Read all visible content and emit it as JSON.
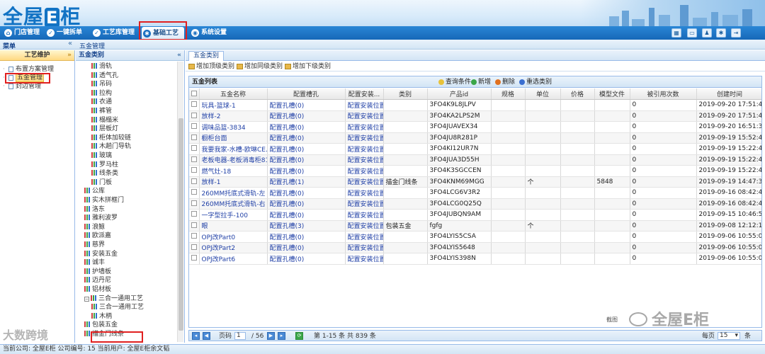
{
  "app": {
    "logo_pre": "全屋",
    "logo_e": "E",
    "logo_post": "柜"
  },
  "nav": {
    "items": [
      {
        "label": "门店管理",
        "icon": "store-icon"
      },
      {
        "label": "一键拆单",
        "icon": "check-icon"
      },
      {
        "label": "工艺库管理",
        "icon": "check-icon"
      },
      {
        "label": "基础工艺",
        "icon": "gear-icon",
        "active": true
      },
      {
        "label": "系统设置",
        "icon": "settings-icon"
      }
    ],
    "tools": [
      "grid-icon",
      "window-icon",
      "user-icon",
      "gear-icon",
      "exit-icon"
    ]
  },
  "crumb": {
    "menu": "菜单",
    "collapse": "«",
    "page": "五金管理"
  },
  "menu": {
    "header": "工艺维护",
    "items": [
      {
        "label": "布置方案管理"
      },
      {
        "label": "五金管理",
        "selected": true
      },
      {
        "label": "封边管理"
      }
    ]
  },
  "tree": {
    "header": "五金类别",
    "nodes": [
      {
        "label": "滑轨",
        "indent": 2
      },
      {
        "label": "透气孔",
        "indent": 2
      },
      {
        "label": "吊码",
        "indent": 2
      },
      {
        "label": "拉构",
        "indent": 2
      },
      {
        "label": "衣通",
        "indent": 2
      },
      {
        "label": "裤管",
        "indent": 2
      },
      {
        "label": "榻榻米",
        "indent": 2
      },
      {
        "label": "层板灯",
        "indent": 2
      },
      {
        "label": "柜体加较链",
        "indent": 2
      },
      {
        "label": "木趟门导轨",
        "indent": 2
      },
      {
        "label": "玻璃",
        "indent": 2
      },
      {
        "label": "罗马柱",
        "indent": 2
      },
      {
        "label": "线条类",
        "indent": 2
      },
      {
        "label": "门板",
        "indent": 2
      },
      {
        "label": "公库",
        "indent": 1
      },
      {
        "label": "实木拼框门",
        "indent": 1
      },
      {
        "label": "洛东",
        "indent": 1
      },
      {
        "label": "雅利波罗",
        "indent": 1
      },
      {
        "label": "浪鲸",
        "indent": 1
      },
      {
        "label": "欧派嘉",
        "indent": 1
      },
      {
        "label": "慈界",
        "indent": 1
      },
      {
        "label": "安装五金",
        "indent": 1
      },
      {
        "label": "诚丰",
        "indent": 1
      },
      {
        "label": "护墙板",
        "indent": 1
      },
      {
        "label": "迈丹尼",
        "indent": 1
      },
      {
        "label": "铝材板",
        "indent": 1
      },
      {
        "label": "三合一通用工艺",
        "indent": 1,
        "expand": "⊟"
      },
      {
        "label": "三合一通用工艺",
        "indent": 2
      },
      {
        "label": "木柄",
        "indent": 2
      },
      {
        "label": "包装五金",
        "indent": 1
      },
      {
        "label": "描金门线条",
        "indent": 1
      }
    ]
  },
  "main": {
    "tab": "五金类别",
    "toolbar": [
      "增加顶级类别",
      "增加同级类别",
      "增加下级类别"
    ],
    "grid_title": "五金列表",
    "actions": [
      {
        "label": "查询条件",
        "color": "#e8c23a"
      },
      {
        "label": "新增",
        "color": "#3aa648"
      },
      {
        "label": "删除",
        "color": "#e07020"
      },
      {
        "label": "重选类别",
        "color": "#3a6ed0"
      }
    ],
    "columns": [
      "",
      "五金名称",
      "配置槽孔",
      "配置安装...",
      "类别",
      "产品id",
      "规格",
      "单位",
      "价格",
      "模型文件",
      "被引用次数",
      "创建时间"
    ],
    "rows": [
      [
        "玩具-篮球-1",
        "配置孔槽(0)",
        "配置安装位置",
        "",
        "3FO4K9L8JLPV",
        "",
        "",
        "",
        "",
        "0",
        "2019-09-20 17:51:45"
      ],
      [
        "放样-2",
        "配置孔槽(0)",
        "配置安装位置",
        "",
        "3FO4KA2LPS2M",
        "",
        "",
        "",
        "",
        "0",
        "2019-09-20 17:51:45"
      ],
      [
        "调味品篮-3834",
        "配置孔槽(0)",
        "配置安装位置",
        "",
        "3FO4JUAVEX34",
        "",
        "",
        "",
        "",
        "0",
        "2019-09-20 16:51:37"
      ],
      [
        "橱柜台面",
        "配置孔槽(0)",
        "配置安装位置",
        "",
        "3FO4JU8R281P",
        "",
        "",
        "",
        "",
        "0",
        "2019-09-19 15:52:45"
      ],
      [
        "我要我家-水槽-欧琳CE...",
        "配置孔槽(0)",
        "配置安装位置",
        "",
        "3FO4KI12UR7N",
        "",
        "",
        "",
        "",
        "0",
        "2019-09-19 15:22:44"
      ],
      [
        "老板电器-老板消毒柜811",
        "配置孔槽(0)",
        "配置安装位置",
        "",
        "3FO4JUA3D55H",
        "",
        "",
        "",
        "",
        "0",
        "2019-09-19 15:22:43"
      ],
      [
        "燃气灶-18",
        "配置孔槽(0)",
        "配置安装位置",
        "",
        "3FO4K3SGCCEN",
        "",
        "",
        "",
        "",
        "0",
        "2019-09-19 15:22:43"
      ],
      [
        "放样-1",
        "配置孔槽(1)",
        "配置安装位置",
        "描金门线条",
        "3FO4KNM69MGG",
        "",
        "个",
        "",
        "5848",
        "0",
        "2019-09-19 14:47:34"
      ],
      [
        "260MM托底式滑轨-左",
        "配置孔槽(0)",
        "配置安装位置",
        "",
        "3FO4LCG6V3R2",
        "",
        "",
        "",
        "",
        "0",
        "2019-09-16 08:42:40"
      ],
      [
        "260MM托底式滑轨-右",
        "配置孔槽(0)",
        "配置安装位置",
        "",
        "3FO4LCG0Q25Q",
        "",
        "",
        "",
        "",
        "0",
        "2019-09-16 08:42:40"
      ],
      [
        "一字型拉手-100",
        "配置孔槽(0)",
        "配置安装位置",
        "",
        "3FO4JUBQN9AM",
        "",
        "",
        "",
        "",
        "0",
        "2019-09-15 10:46:59"
      ],
      [
        "眼",
        "配置孔槽(3)",
        "配置安装位置",
        "包装五金",
        "fgfg",
        "",
        "个",
        "",
        "",
        "0",
        "2019-09-08 12:12:19"
      ],
      [
        "OPJ改Part0",
        "配置孔槽(0)",
        "配置安装位置",
        "",
        "3FO4LYIS5CSA",
        "",
        "",
        "",
        "",
        "0",
        "2019-09-06 10:55:08"
      ],
      [
        "OPJ改Part2",
        "配置孔槽(0)",
        "配置安装位置",
        "",
        "3FO4LYIS5648",
        "",
        "",
        "",
        "",
        "0",
        "2019-09-06 10:55:08"
      ],
      [
        "OPJ改Part6",
        "配置孔槽(0)",
        "配置安装位置",
        "",
        "3FO4LYIS398N",
        "",
        "",
        "",
        "",
        "0",
        "2019-09-06 10:55:08"
      ]
    ],
    "pager": {
      "page_label": "页码",
      "page": "1",
      "of": "/ 56",
      "summary": "第 1-15 条 共 839 条",
      "per_page_label": "每页",
      "per_page": "15",
      "per_page_suffix": "条"
    }
  },
  "status": "当前公司: 全屋E柜   公司编号: 15   当前用户: 全屋E柜余文韬",
  "watermarks": {
    "left": "大数跨境",
    "right": "全屋E柜",
    "snippet": "截图"
  }
}
